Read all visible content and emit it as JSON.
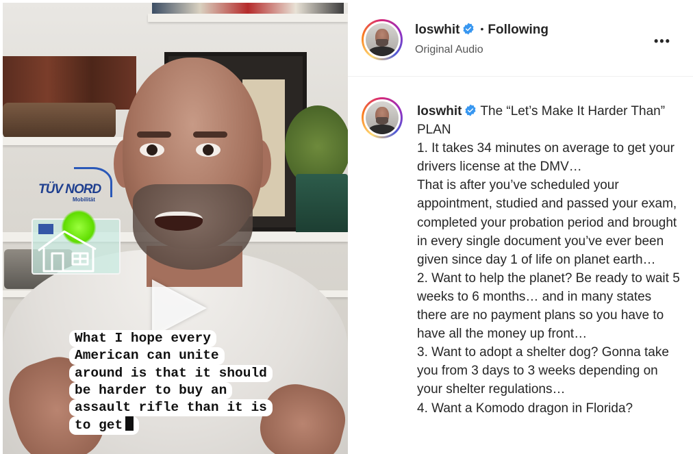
{
  "video": {
    "sticker_brand": "TÜV NORD",
    "sticker_sub": "Mobilität",
    "caption_lines": [
      "What I hope every",
      "American can unite",
      "around is that it should",
      "be harder to buy an",
      "assault rifle than it is",
      "to get"
    ]
  },
  "header": {
    "username": "loswhit",
    "separator": "•",
    "follow_status": "Following",
    "audio": "Original Audio",
    "more_label": "•••"
  },
  "post": {
    "username": "loswhit",
    "title": "The “Let’s Make It Harder Than” PLAN",
    "paragraphs": [
      "1. It takes 34 minutes on average to get your drivers license at the DMV…",
      "That is after you’ve scheduled your appointment, studied and passed your exam, completed your probation period and brought in every single document you’ve ever been given since day 1 of life on planet earth…",
      "2. Want to help the planet? Be ready to wait 5 weeks to 6 months… and in many states there are no payment plans so you have to have all the money up front…",
      "3. Want to adopt a shelter dog? Gonna take you from 3 days to 3 weeks depending on your shelter regulations…",
      "4. Want a Komodo dragon in Florida?"
    ]
  },
  "colors": {
    "verified_blue": "#3897f0",
    "text": "#262626",
    "secondary_text": "#555555"
  }
}
